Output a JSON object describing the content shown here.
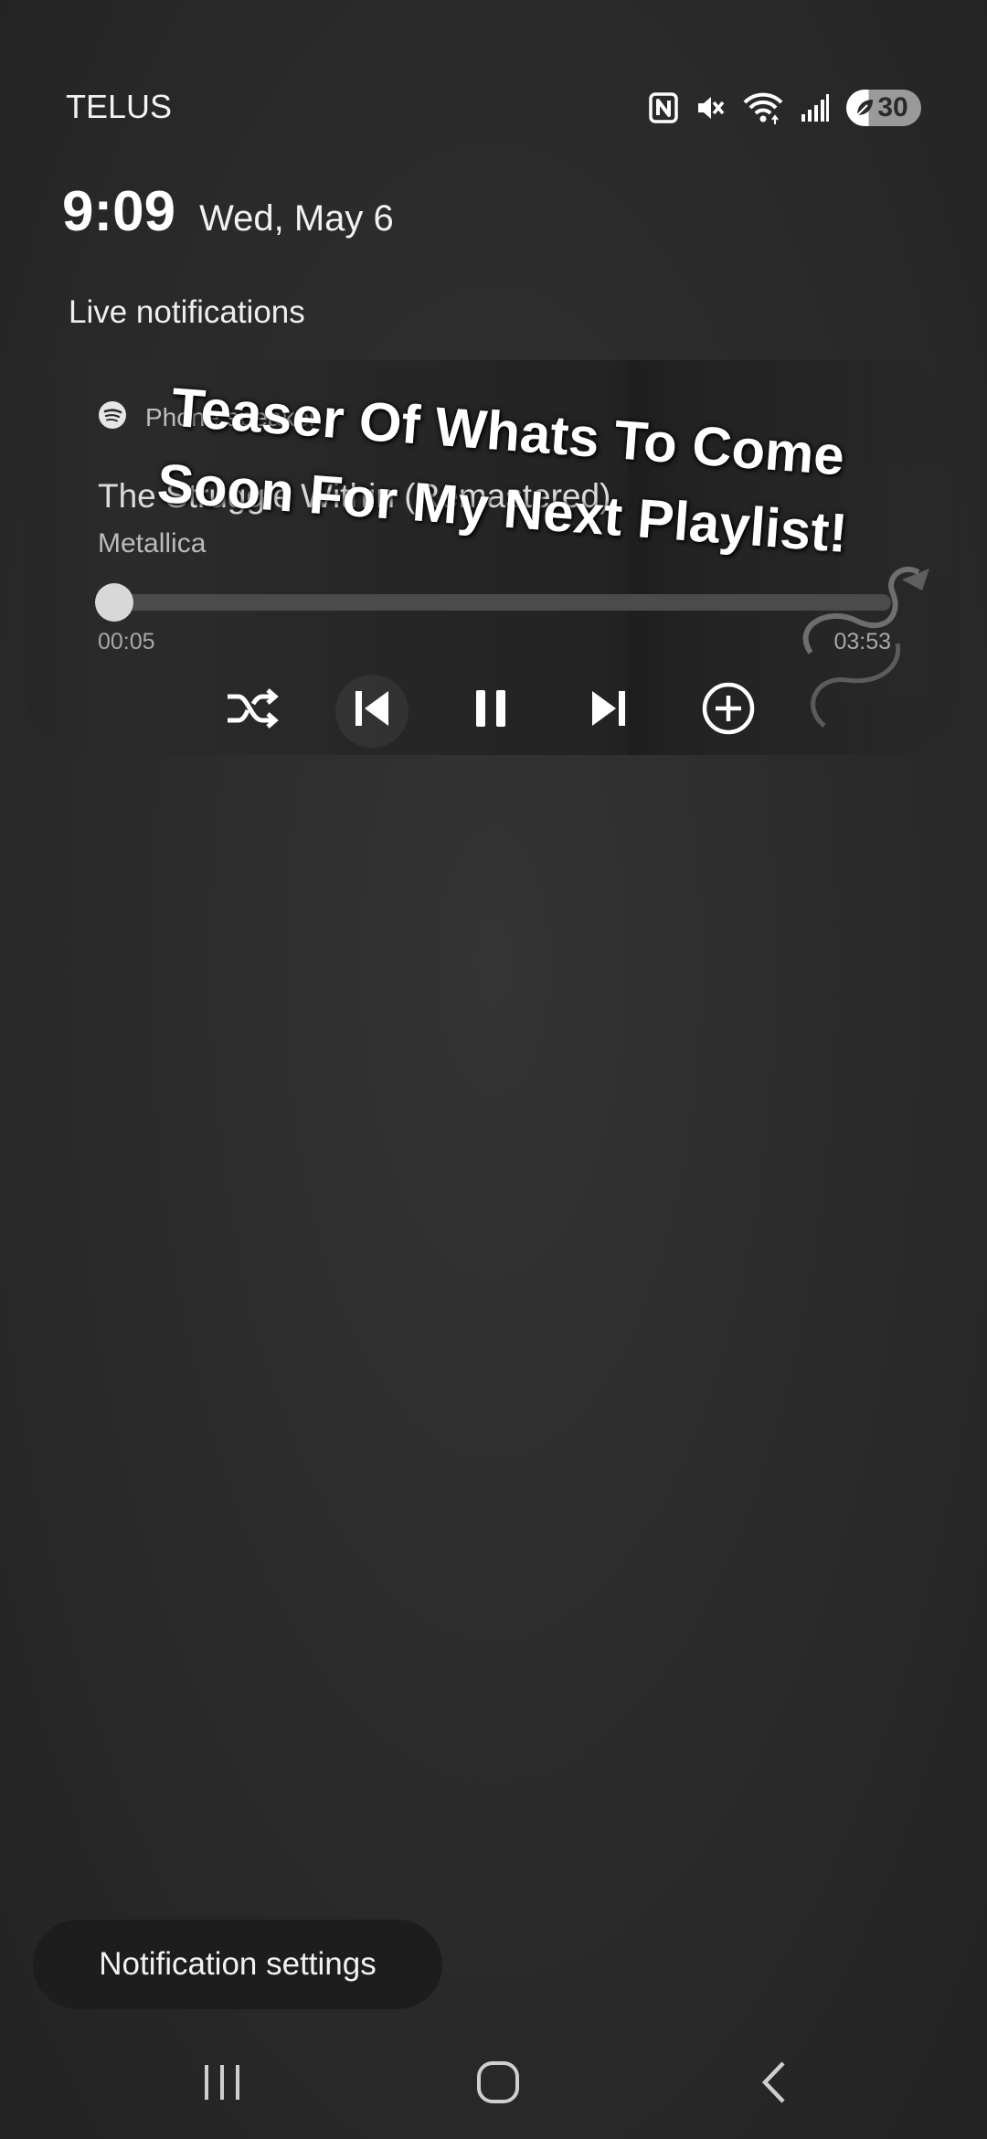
{
  "status_bar": {
    "carrier": "TELUS",
    "battery_level": "30",
    "icons": [
      "nfc-icon",
      "mute-icon",
      "wifi-icon",
      "signal-icon",
      "battery-saver-icon"
    ]
  },
  "lockscreen": {
    "time": "9:09",
    "date": "Wed, May 6"
  },
  "live_notifications": {
    "title": "Live notifications"
  },
  "media_player": {
    "app_icon": "spotify-icon",
    "source": "Phone speaker",
    "track_title": "The Struggle Within (Remastered)",
    "artist": "Metallica",
    "elapsed": "00:05",
    "duration": "03:53",
    "progress_fraction": 0.021,
    "controls": [
      "shuffle-icon",
      "previous-icon",
      "pause-icon",
      "next-icon",
      "add-icon"
    ]
  },
  "overlay_caption": {
    "line1": "Teaser Of Whats To Come",
    "line2": "Soon For My Next Playlist!"
  },
  "notification_settings": {
    "label": "Notification settings"
  },
  "nav_bar": {
    "icons": [
      "recents-icon",
      "home-icon",
      "back-icon"
    ]
  }
}
